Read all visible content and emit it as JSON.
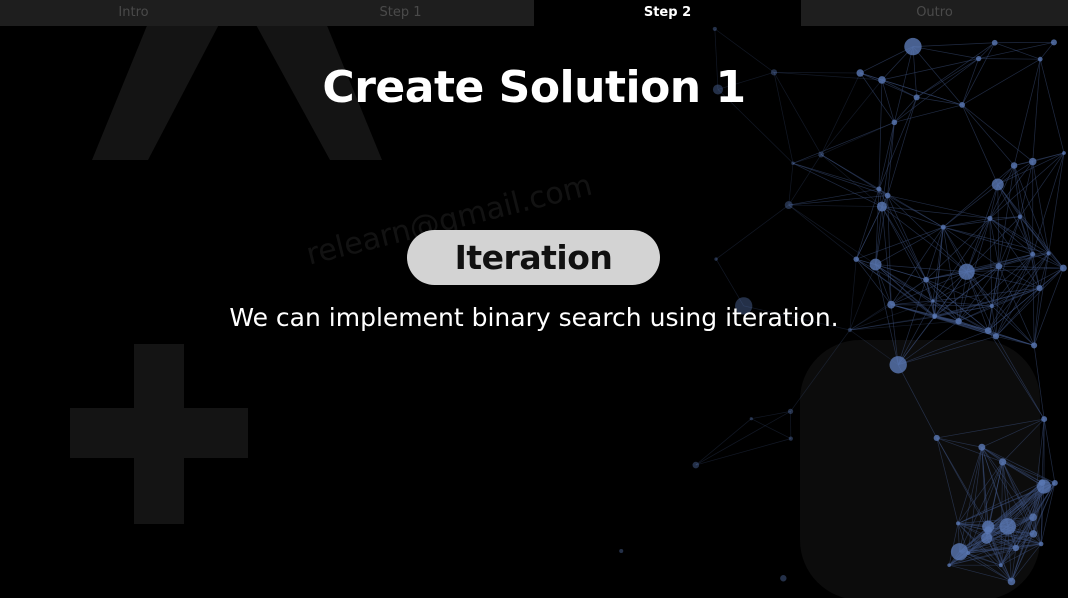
{
  "tabs": [
    {
      "label": "Intro",
      "active": false
    },
    {
      "label": "Step 1",
      "active": false
    },
    {
      "label": "Step 2",
      "active": true
    },
    {
      "label": "Outro",
      "active": false
    }
  ],
  "slide": {
    "title": "Create Solution 1",
    "badge": "Iteration",
    "description": "We can implement binary search using iteration."
  },
  "colors": {
    "background": "#000000",
    "tab_inactive_bg": "#1e1e1e",
    "tab_inactive_text": "#4a4a4a",
    "tab_active_text": "#ffffff",
    "badge_bg": "#d3d3d3",
    "network_nodes": "#5a78b4"
  },
  "watermark": "relearn@gmail.com",
  "decor_icons": [
    "large-a-letter-shape",
    "plus-shape",
    "network-graph"
  ]
}
